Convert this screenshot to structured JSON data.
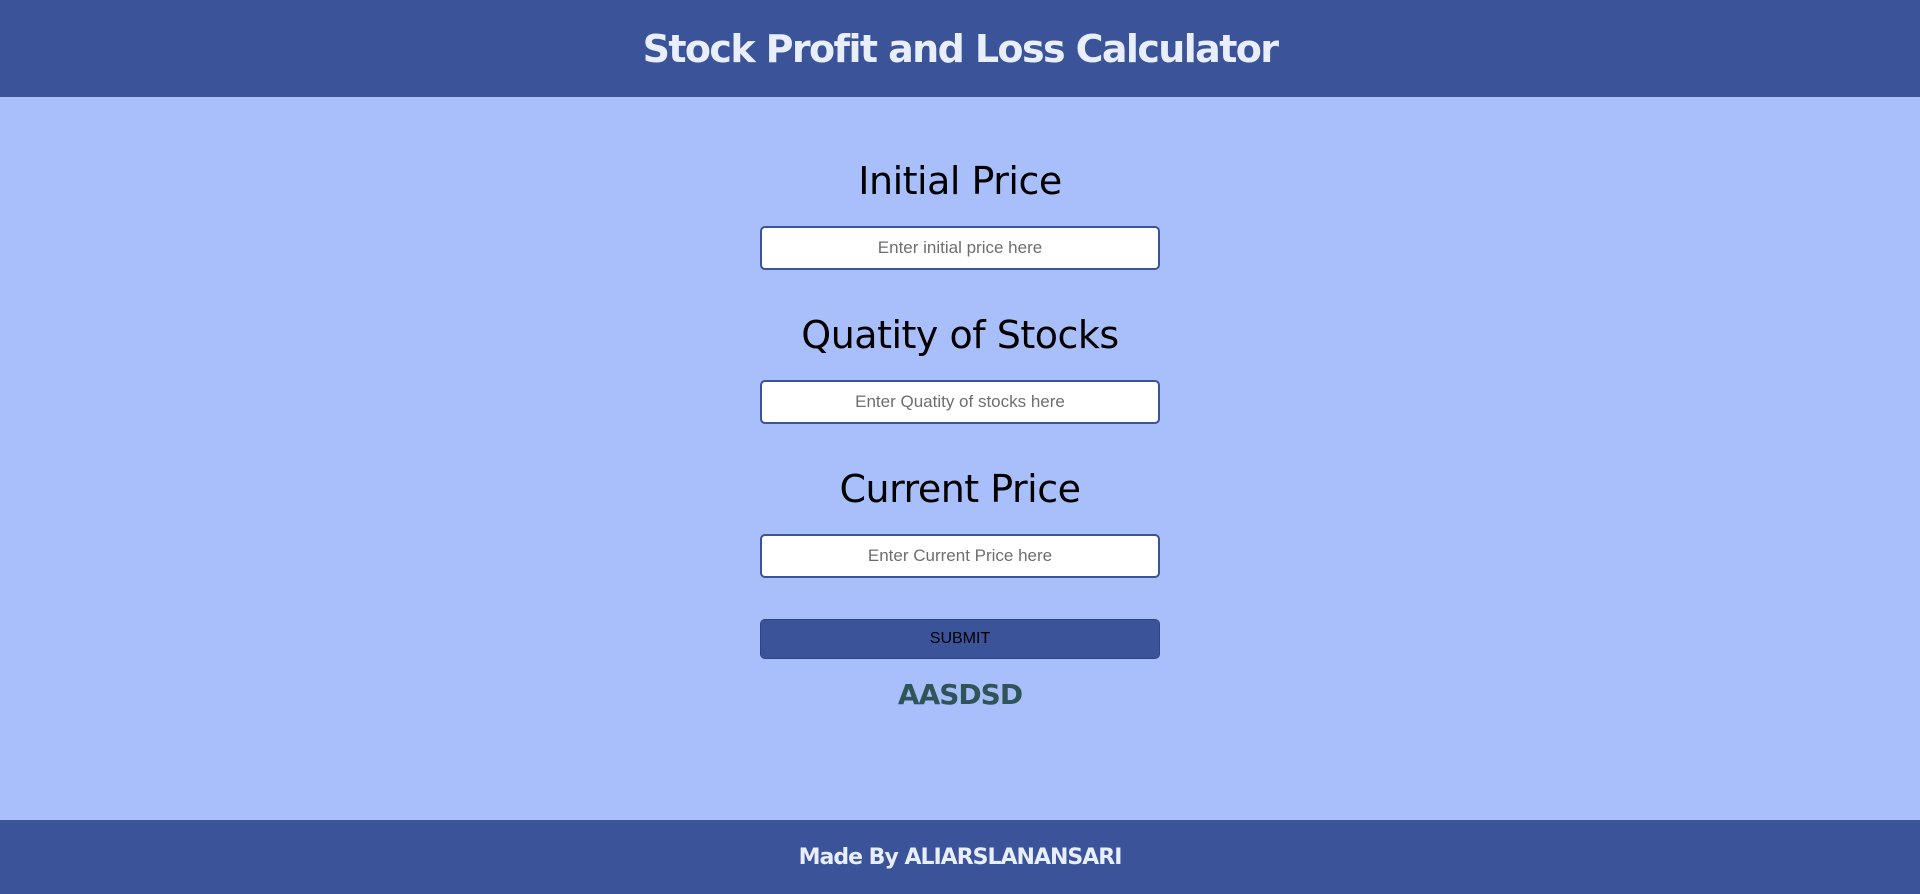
{
  "header": {
    "title": "Stock Profit and Loss Calculator"
  },
  "form": {
    "initial_price": {
      "label": "Initial Price",
      "placeholder": "Enter initial price here",
      "value": ""
    },
    "quantity": {
      "label": "Quatity of Stocks",
      "placeholder": "Enter Quatity of stocks here",
      "value": ""
    },
    "current_price": {
      "label": "Current Price",
      "placeholder": "Enter Current Price here",
      "value": ""
    },
    "submit_label": "SUBMIT"
  },
  "output": {
    "message": "AASDSD"
  },
  "footer": {
    "text": "Made By ALIARSLANANSARI"
  },
  "colors": {
    "background": "#a9bffb",
    "bar": "#3b5499",
    "output_text": "#2f5559"
  }
}
